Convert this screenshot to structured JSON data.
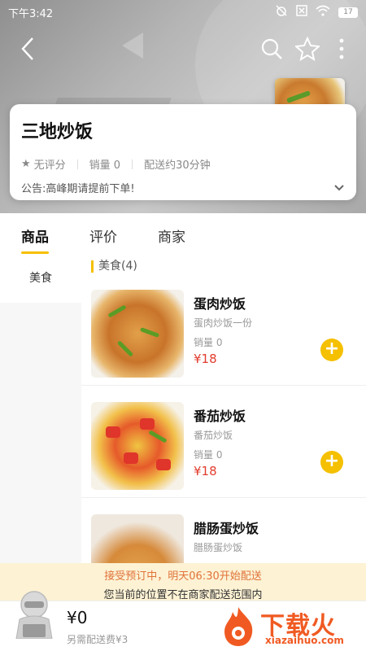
{
  "status_bar": {
    "time": "下午3:42",
    "battery": "17"
  },
  "shop": {
    "name": "三地炒饭",
    "rating": "无评分",
    "sales": "销量 0",
    "delivery": "配送约30分钟",
    "notice": "公告:高峰期请提前下单!"
  },
  "tabs": [
    {
      "label": "商品"
    },
    {
      "label": "评价"
    },
    {
      "label": "商家"
    }
  ],
  "categories": [
    {
      "label": "美食"
    }
  ],
  "section": {
    "title": "美食(4)"
  },
  "dishes": [
    {
      "name": "蛋肉炒饭",
      "desc": "蛋肉炒饭一份",
      "sales": "销量 0",
      "price": "¥18"
    },
    {
      "name": "番茄炒饭",
      "desc": "番茄炒饭",
      "sales": "销量 0",
      "price": "¥18"
    },
    {
      "name": "腊肠蛋炒饭",
      "desc": "腊肠蛋炒饭",
      "sales": "",
      "price": ""
    }
  ],
  "order_notice": {
    "line1": "接受预订中，明天06:30开始配送",
    "line2": "您当前的位置不在商家配送范围内"
  },
  "cart": {
    "total": "¥0",
    "delivery_fee": "另需配送费¥3"
  },
  "watermark": {
    "text": "下载火",
    "url": "xiazaihuo.com"
  },
  "colors": {
    "accent": "#f5c000",
    "price": "#e23c2e",
    "notice_text": "#e0733a",
    "watermark": "#f05a22"
  },
  "icons": [
    "back-icon",
    "search-icon",
    "star-icon",
    "more-icon",
    "chevron-down-icon",
    "add-icon",
    "cart-icon"
  ]
}
